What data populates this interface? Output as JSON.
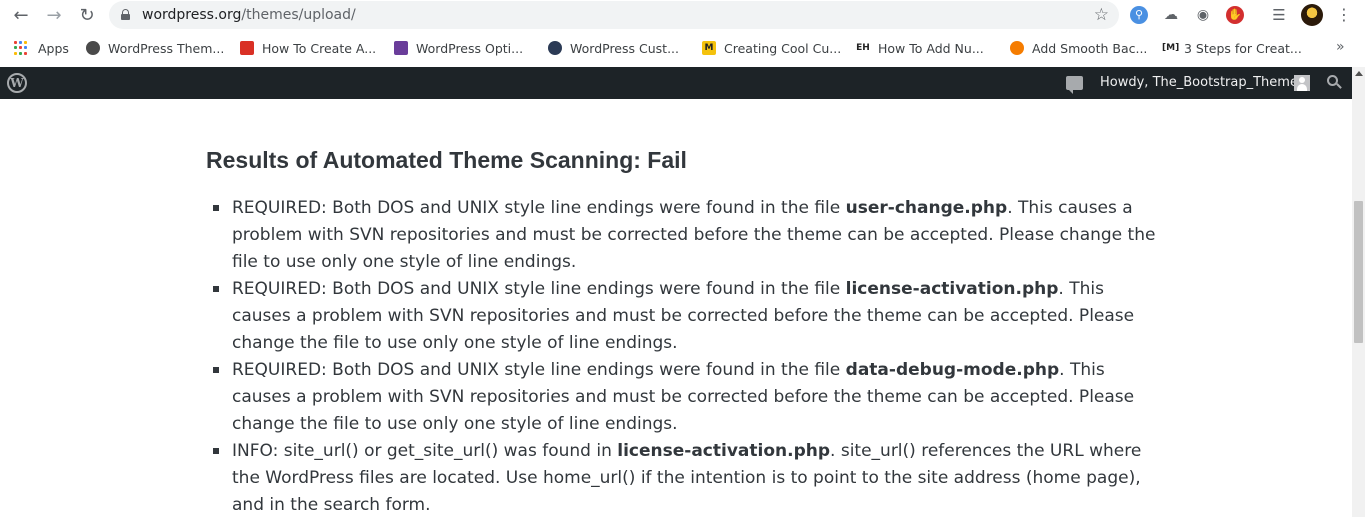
{
  "browser": {
    "url_host": "wordpress.org",
    "url_path": "/themes/upload/"
  },
  "bookmarks": {
    "apps_label": "Apps",
    "items": [
      {
        "label": "WordPress Them...",
        "color": "#4a4a4a"
      },
      {
        "label": "How To Create A...",
        "color": "#d93025"
      },
      {
        "label": "WordPress Opti...",
        "color": "#6a3d9a"
      },
      {
        "label": "WordPress Cust...",
        "color": "#2b3a55"
      },
      {
        "label": "Creating Cool Cu...",
        "color": "#f4c20d"
      },
      {
        "label": "How To Add Nu...",
        "color": "#222222"
      },
      {
        "label": "Add Smooth Bac...",
        "color": "#f57c00"
      },
      {
        "label": "3 Steps for Creat...",
        "color": "#222222"
      }
    ],
    "more_label": "»"
  },
  "admin_bar": {
    "howdy": "Howdy, The_Bootstrap_Themes"
  },
  "content": {
    "title": "Results of Automated Theme Scanning: Fail",
    "items": [
      {
        "pre": "REQUIRED: Both DOS and UNIX style line endings were found in the file ",
        "file": "user-change.php",
        "post": ". This causes a problem with SVN repositories and must be corrected before the theme can be accepted. Please change the file to use only one style of line endings."
      },
      {
        "pre": "REQUIRED: Both DOS and UNIX style line endings were found in the file ",
        "file": "license-activation.php",
        "post": ". This causes a problem with SVN repositories and must be corrected before the theme can be accepted. Please change the file to use only one style of line endings."
      },
      {
        "pre": "REQUIRED: Both DOS and UNIX style line endings were found in the file ",
        "file": "data-debug-mode.php",
        "post": ". This causes a problem with SVN repositories and must be corrected before the theme can be accepted. Please change the file to use only one style of line endings."
      },
      {
        "pre": "INFO: site_url() or get_site_url() was found in ",
        "file": "license-activation.php",
        "post": ". site_url() references the URL where the WordPress files are located. Use home_url() if the intention is to point to the site address (home page), and in the search form."
      }
    ]
  }
}
